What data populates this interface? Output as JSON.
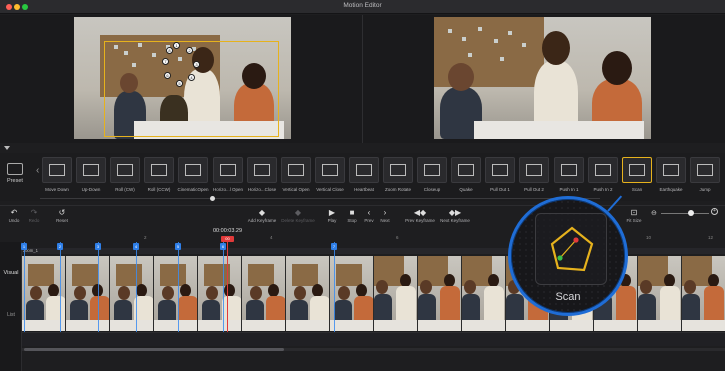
{
  "window": {
    "title": "Motion Editor"
  },
  "preview": {
    "keyframe_markers": [
      "1",
      "2",
      "3",
      "4",
      "5",
      "6",
      "7",
      "8"
    ]
  },
  "presets": {
    "label": "Preset",
    "items": [
      {
        "label": "Move Down"
      },
      {
        "label": "Up-Down"
      },
      {
        "label": "Roll (CW)"
      },
      {
        "label": "Roll (CCW)"
      },
      {
        "label": "CinematicOpen"
      },
      {
        "label": "Horizo...l Open"
      },
      {
        "label": "Horizo...Close"
      },
      {
        "label": "Vertical Open"
      },
      {
        "label": "Vertical Close"
      },
      {
        "label": "Heartbeat"
      },
      {
        "label": "Zoom Rotate"
      },
      {
        "label": "Closeup"
      },
      {
        "label": "Quake"
      },
      {
        "label": "Pull Out 1"
      },
      {
        "label": "Pull Out 2"
      },
      {
        "label": "Push In 1"
      },
      {
        "label": "Push In 2"
      },
      {
        "label": "Scan"
      },
      {
        "label": "Earthquake"
      },
      {
        "label": "Jump"
      }
    ]
  },
  "toolbar": {
    "undo": "Undo",
    "redo": "Redo",
    "reset": "Reset",
    "add_keyframe": "Add Keyframe",
    "delete_keyframe": "Delete Keyframe",
    "play": "Play",
    "stop": "Stop",
    "prev": "Prev",
    "next": "Next",
    "prev_keyframe": "Prev Keyframe",
    "next_keyframe": "Next Keyframe",
    "fit_size": "Fit Size",
    "timecode": "00:00:03.29"
  },
  "timeline": {
    "ruler": [
      "2",
      "4",
      "6",
      "8",
      "10",
      "12"
    ],
    "track_name": "zoom_1",
    "side_visual": "Visual",
    "side_list": "List",
    "keyframes": [
      "1",
      "2",
      "3",
      "4",
      "5",
      "6",
      "7"
    ],
    "playhead_tag": "00"
  },
  "callout": {
    "label": "Scan"
  },
  "colors": {
    "accent": "#e6b21d",
    "keyframe": "#2f7fe8",
    "playhead": "#e23a3a",
    "callout_ring": "#1f6dd6"
  }
}
